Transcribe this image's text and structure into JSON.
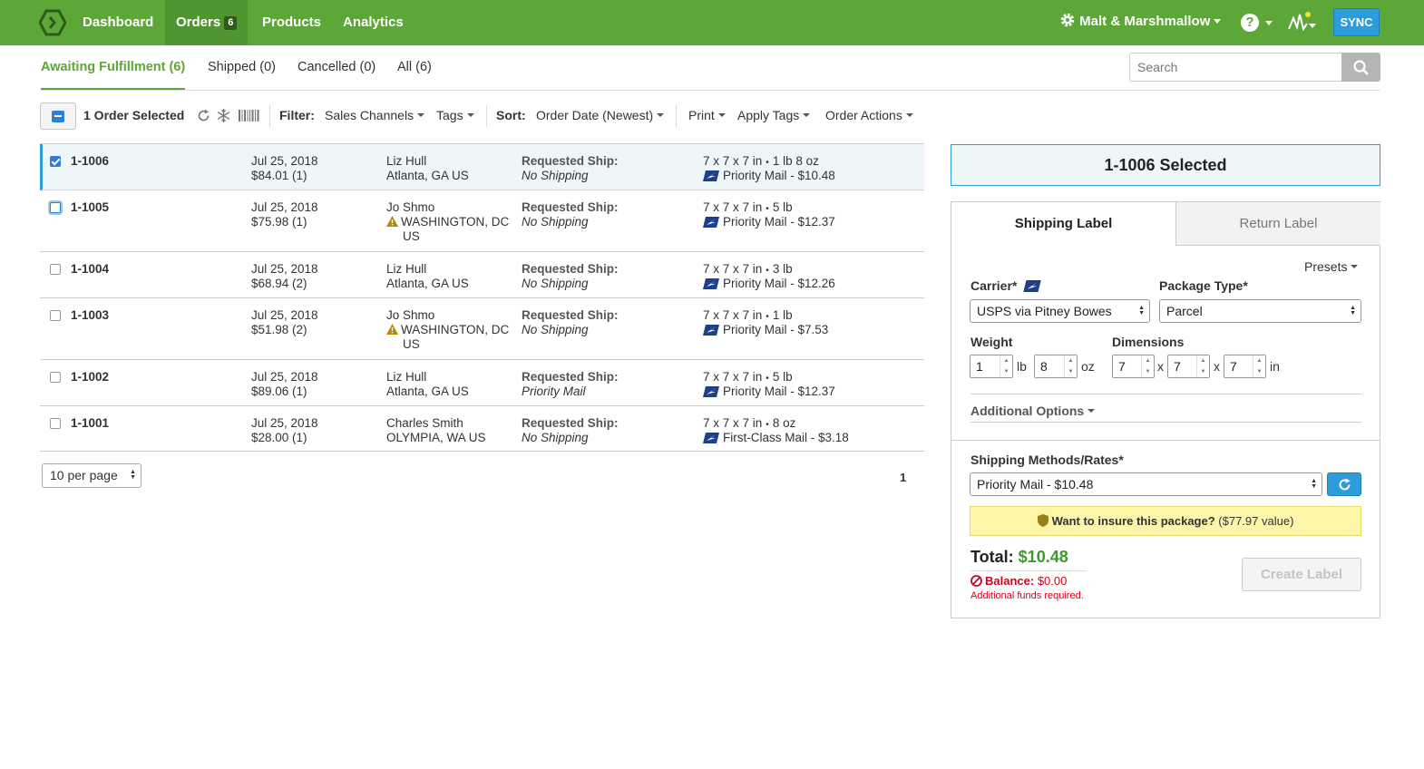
{
  "nav": {
    "items": [
      {
        "label": "Dashboard"
      },
      {
        "label": "Orders",
        "badge": "6"
      },
      {
        "label": "Products"
      },
      {
        "label": "Analytics"
      }
    ],
    "account": "Malt & Marshmallow",
    "help": "?",
    "sync": "SYNC"
  },
  "status_tabs": [
    {
      "label": "Awaiting Fulfillment (6)"
    },
    {
      "label": "Shipped (0)"
    },
    {
      "label": "Cancelled (0)"
    },
    {
      "label": "All (6)"
    }
  ],
  "search": {
    "placeholder": "Search"
  },
  "toolbar": {
    "selected": "1 Order Selected",
    "filter_label": "Filter:",
    "sales_channels": "Sales Channels",
    "tags": "Tags",
    "sort_label": "Sort:",
    "sort_value": "Order Date (Newest)",
    "print": "Print",
    "apply_tags": "Apply Tags",
    "order_actions": "Order Actions"
  },
  "orders": [
    {
      "id": "1-1006",
      "date": "Jul 25, 2018",
      "total": "$84.01 (1)",
      "name": "Liz Hull",
      "addr1": "Atlanta, GA US",
      "addr2": "",
      "ship_label": "Requested Ship:",
      "ship_value": "No Shipping",
      "dims": "7 x 7 x 7 in",
      "weight": "1 lb  8 oz",
      "service": "Priority Mail - $10.48"
    },
    {
      "id": "1-1005",
      "date": "Jul 25, 2018",
      "total": "$75.98 (1)",
      "name": "Jo Shmo",
      "addr1": "WASHINGTON, DC",
      "addr2": "US",
      "ship_label": "Requested Ship:",
      "ship_value": "No Shipping",
      "dims": "7 x 7 x 7 in",
      "weight": "5 lb",
      "service": "Priority Mail - $12.37"
    },
    {
      "id": "1-1004",
      "date": "Jul 25, 2018",
      "total": "$68.94 (2)",
      "name": "Liz Hull",
      "addr1": "Atlanta, GA US",
      "addr2": "",
      "ship_label": "Requested Ship:",
      "ship_value": "No Shipping",
      "dims": "7 x 7 x 7 in",
      "weight": "3 lb",
      "service": "Priority Mail - $12.26"
    },
    {
      "id": "1-1003",
      "date": "Jul 25, 2018",
      "total": "$51.98 (2)",
      "name": "Jo Shmo",
      "addr1": "WASHINGTON, DC",
      "addr2": "US",
      "ship_label": "Requested Ship:",
      "ship_value": "No Shipping",
      "dims": "7 x 7 x 7 in",
      "weight": "1 lb",
      "service": "Priority Mail - $7.53"
    },
    {
      "id": "1-1002",
      "date": "Jul 25, 2018",
      "total": "$89.06 (1)",
      "name": "Liz Hull",
      "addr1": "Atlanta, GA US",
      "addr2": "",
      "ship_label": "Requested Ship:",
      "ship_value": "Priority Mail",
      "dims": "7 x 7 x 7 in",
      "weight": "5 lb",
      "service": "Priority Mail - $12.37"
    },
    {
      "id": "1-1001",
      "date": "Jul 25, 2018",
      "total": "$28.00 (1)",
      "name": "Charles Smith",
      "addr1": "OLYMPIA, WA US",
      "addr2": "",
      "ship_label": "Requested Ship:",
      "ship_value": "No Shipping",
      "dims": "7 x 7 x 7 in",
      "weight": "8 oz",
      "service": "First-Class Mail - $3.18"
    }
  ],
  "pagination": {
    "per_page": "10 per page",
    "page": "1"
  },
  "panel": {
    "header": "1-1006 Selected",
    "tab_shipping": "Shipping Label",
    "tab_return": "Return Label",
    "presets": "Presets",
    "carrier_label": "Carrier*",
    "carrier_value": "USPS via Pitney Bowes",
    "package_label": "Package Type*",
    "package_value": "Parcel",
    "weight_label": "Weight",
    "weight_lb": "1",
    "lb": "lb",
    "weight_oz": "8",
    "oz": "oz",
    "dims_label": "Dimensions",
    "dim_l": "7",
    "dim_w": "7",
    "dim_h": "7",
    "x": "x",
    "in": "in",
    "additional": "Additional Options",
    "methods_label": "Shipping Methods/Rates*",
    "method_value": "Priority Mail - $10.48",
    "insure_bold": "Want to insure this package?",
    "insure_value": "($77.97 value)",
    "total_label": "Total:",
    "total_value": "$10.48",
    "balance_label": "Balance:",
    "balance_value": "$0.00",
    "funds_note": "Additional funds required.",
    "create_label": "Create Label"
  }
}
